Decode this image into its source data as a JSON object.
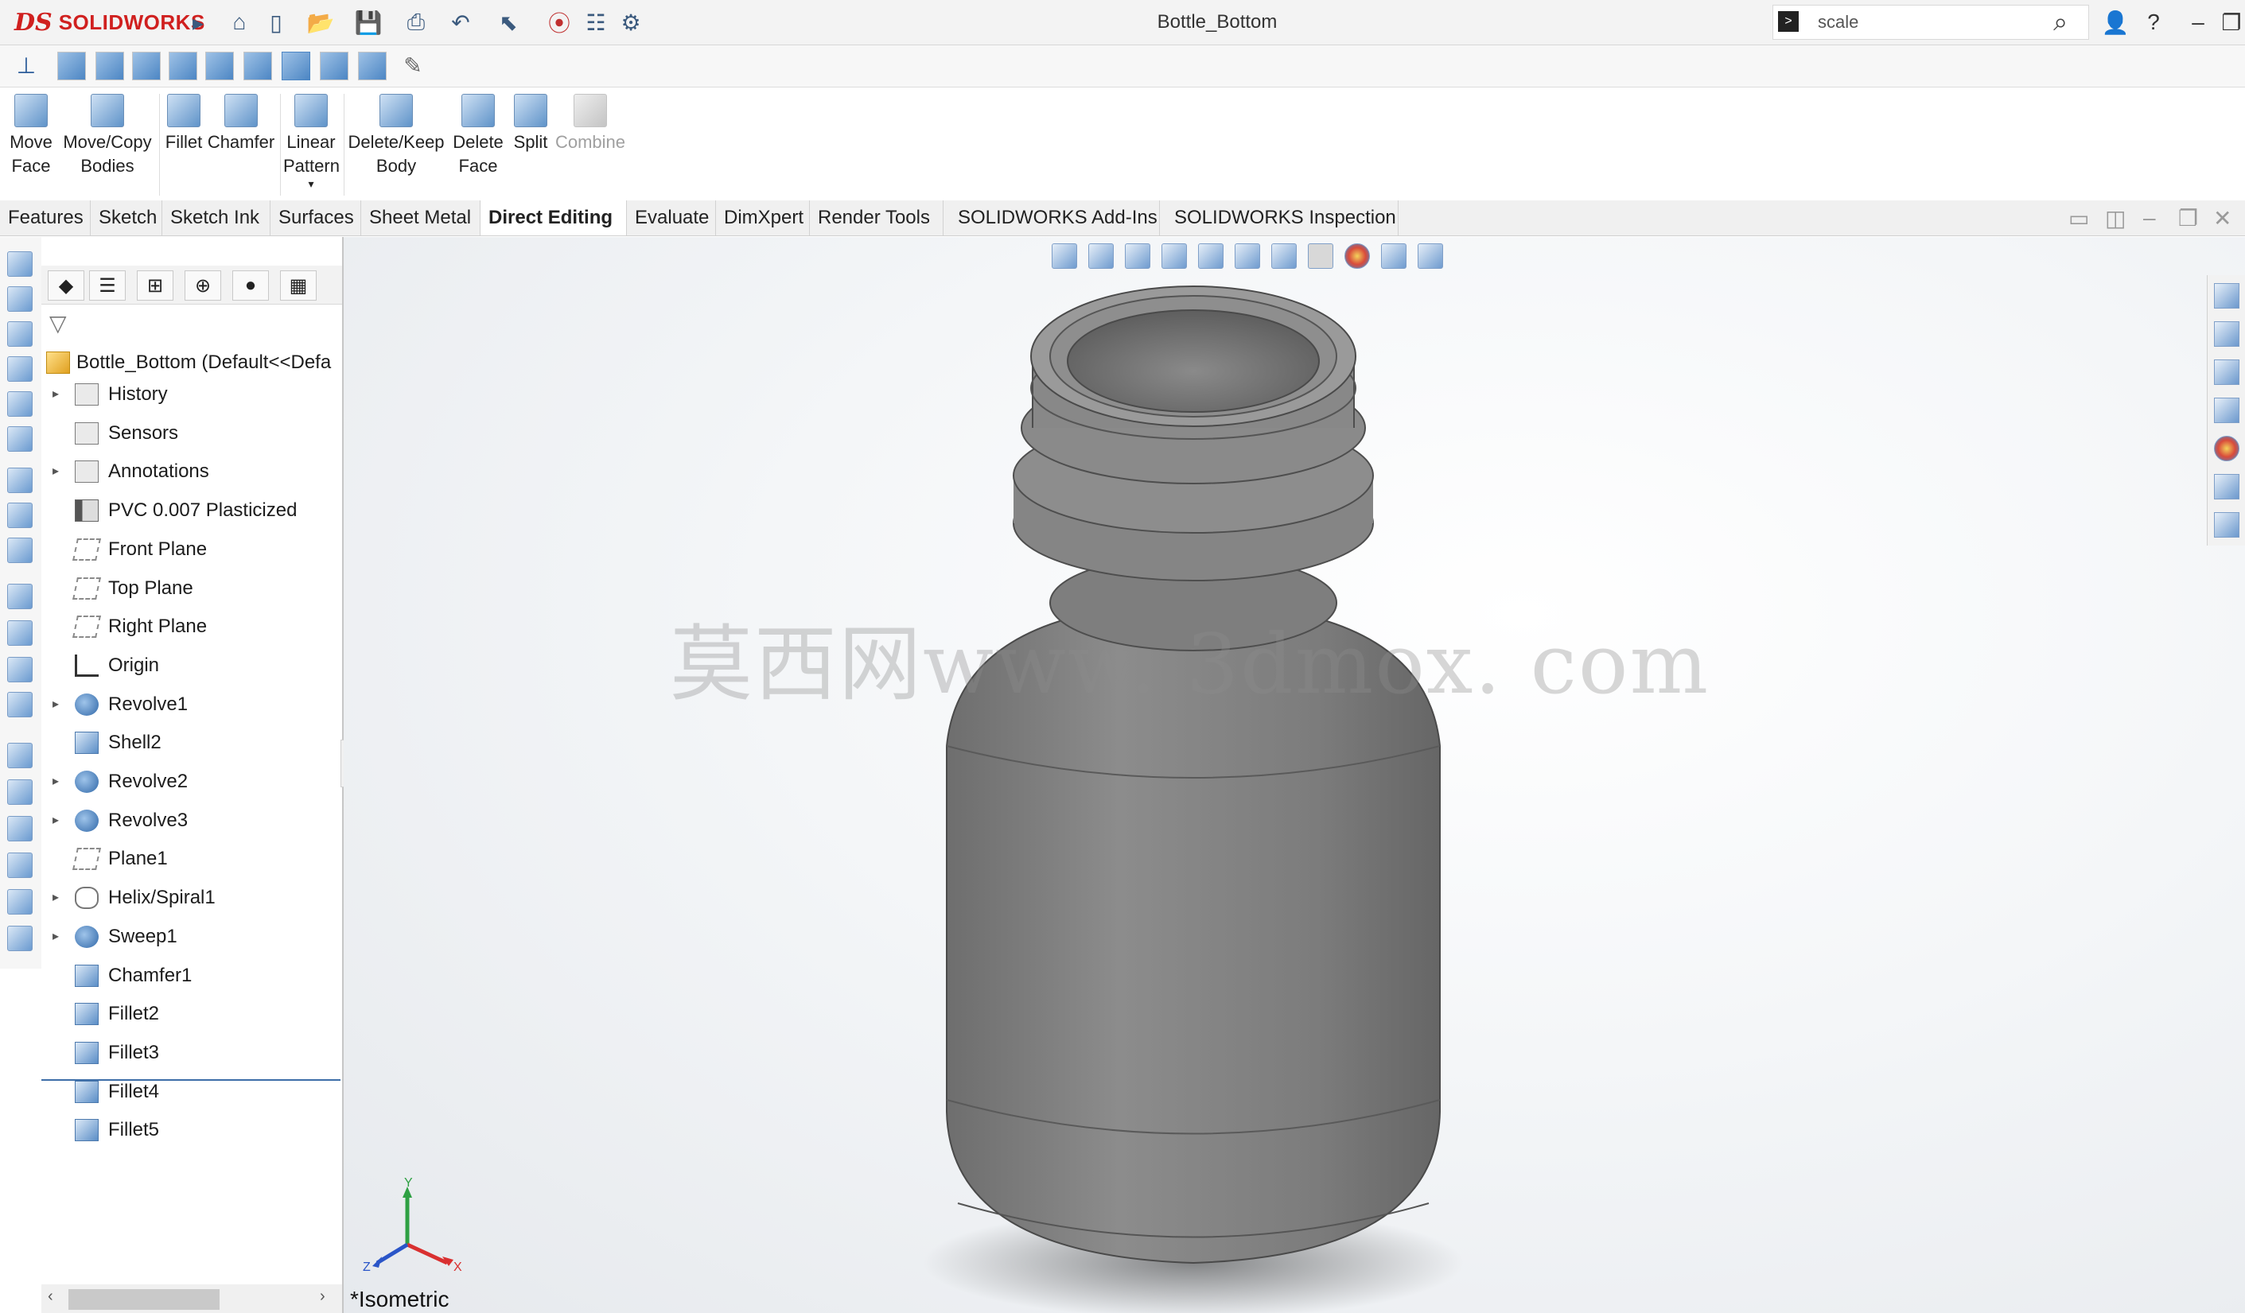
{
  "app": {
    "brand_prefix": "DS",
    "brand_name": "SOLIDWORKS",
    "document_title": "Bottle_Bottom"
  },
  "search": {
    "value": "scale"
  },
  "command_manager": [
    {
      "label1": "Move",
      "label2": "Face"
    },
    {
      "label1": "Move/Copy",
      "label2": "Bodies"
    },
    {
      "label1": "Fillet",
      "label2": ""
    },
    {
      "label1": "Chamfer",
      "label2": ""
    },
    {
      "label1": "Linear",
      "label2": "Pattern"
    },
    {
      "label1": "Delete/Keep",
      "label2": "Body"
    },
    {
      "label1": "Delete",
      "label2": "Face"
    },
    {
      "label1": "Split",
      "label2": ""
    },
    {
      "label1": "Combine",
      "label2": "",
      "disabled": true
    }
  ],
  "tabs": [
    "Features",
    "Sketch",
    "Sketch Ink",
    "Surfaces",
    "Sheet Metal",
    "Direct Editing",
    "Evaluate",
    "DimXpert",
    "Render Tools",
    "SOLIDWORKS Add-Ins",
    "SOLIDWORKS Inspection"
  ],
  "active_tab": "Direct Editing",
  "feature_tree": {
    "root": "Bottle_Bottom  (Default<<Defa",
    "items": [
      "History",
      "Sensors",
      "Annotations",
      "PVC 0.007 Plasticized",
      "Front Plane",
      "Top Plane",
      "Right Plane",
      "Origin",
      "Revolve1",
      "Shell2",
      "Revolve2",
      "Revolve3",
      "Plane1",
      "Helix/Spiral1",
      "Sweep1",
      "Chamfer1",
      "Fillet2",
      "Fillet3",
      "Fillet4",
      "Fillet5"
    ]
  },
  "viewport": {
    "watermark": "莫西网www. 3dmox. com",
    "view_label": "*Isometric",
    "triad": {
      "x": "X",
      "y": "Y",
      "z": "Z"
    }
  },
  "colors": {
    "brand_red": "#d0201f",
    "model_gray": "#7d7d7d",
    "tree_accent": "#3d6ea8"
  }
}
